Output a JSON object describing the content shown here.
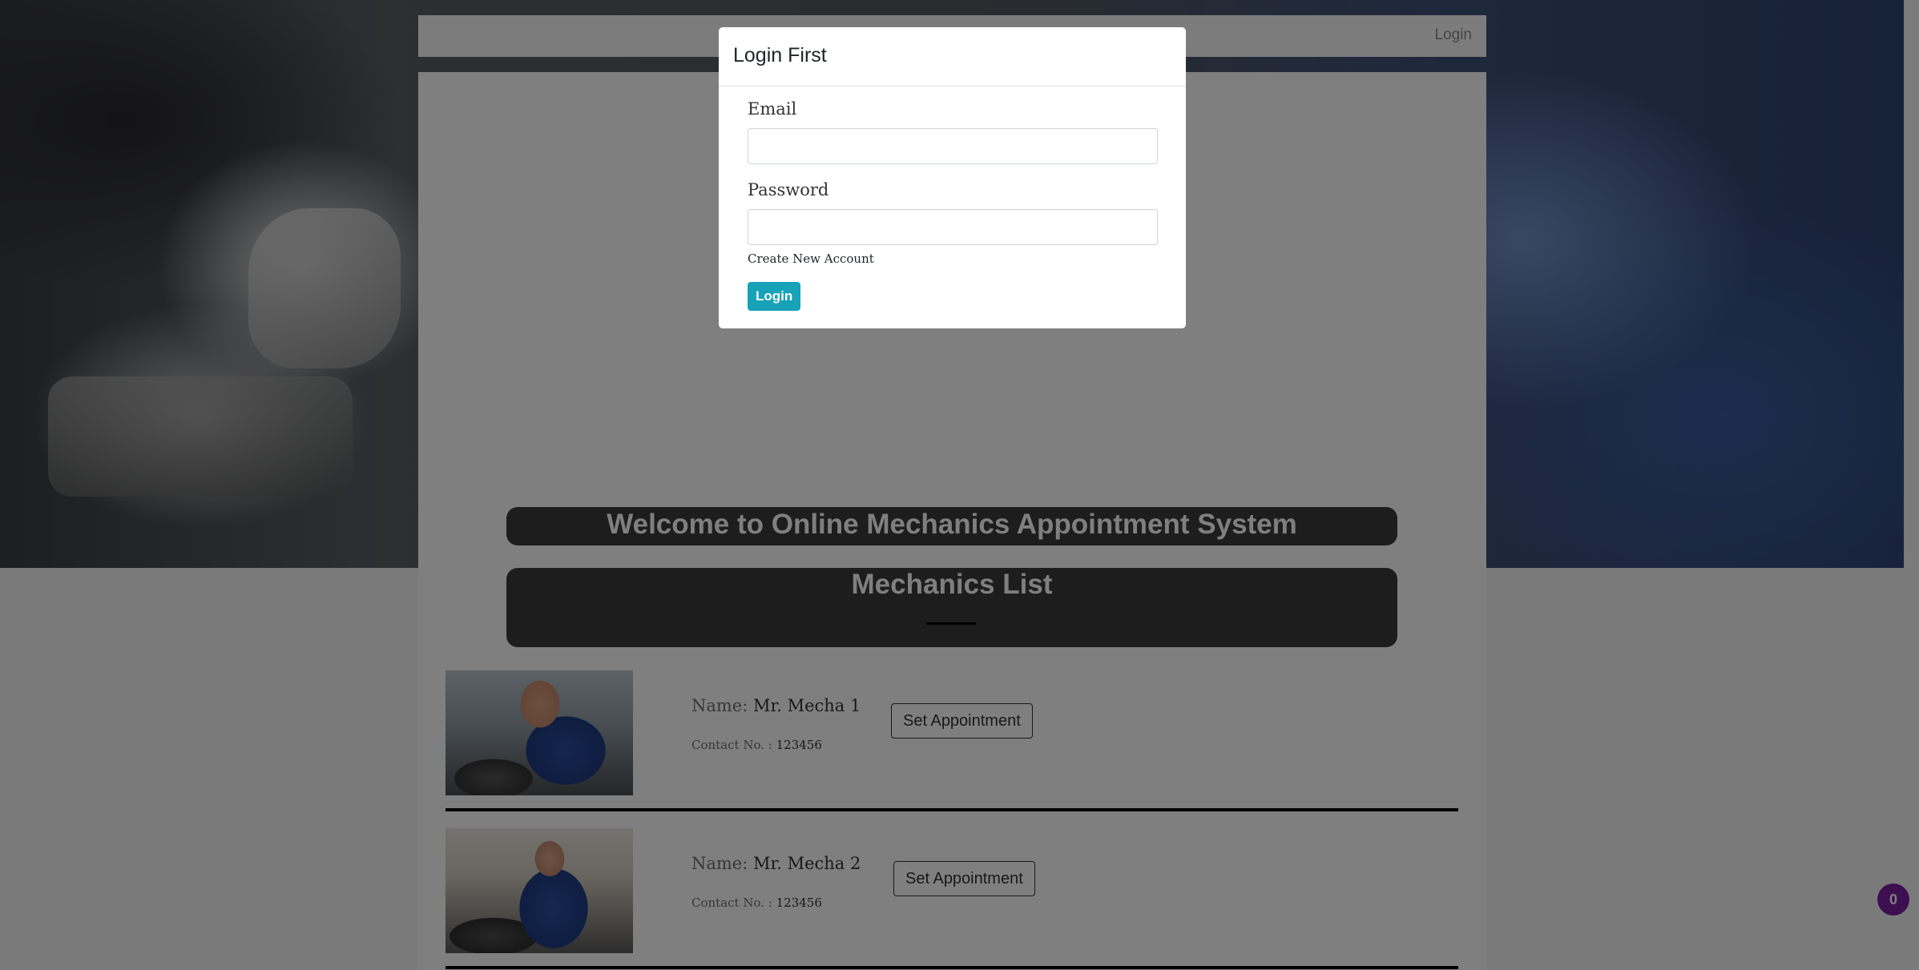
{
  "navbar": {
    "login_label": "Login"
  },
  "main": {
    "welcome_text": "Welcome to Online Mechanics Appointment System",
    "section_title": "Mechanics List",
    "mechanics": [
      {
        "name_label": "Name:",
        "name": "Mr. Mecha 1",
        "contact_label": "Contact No. :",
        "contact": "123456",
        "button_label": "Set Appointment"
      },
      {
        "name_label": "Name:",
        "name": "Mr. Mecha 2",
        "contact_label": "Contact No. :",
        "contact": "123456",
        "button_label": "Set Appointment"
      }
    ]
  },
  "cart": {
    "count": "0"
  },
  "modal": {
    "title": "Login First",
    "email_label": "Email",
    "email_value": "",
    "password_label": "Password",
    "password_value": "",
    "create_account_label": "Create New Account",
    "login_button_label": "Login"
  },
  "colors": {
    "accent": "#17a2b8",
    "badge": "#7b1fa2",
    "dark_bar": "#3a3a3a"
  }
}
